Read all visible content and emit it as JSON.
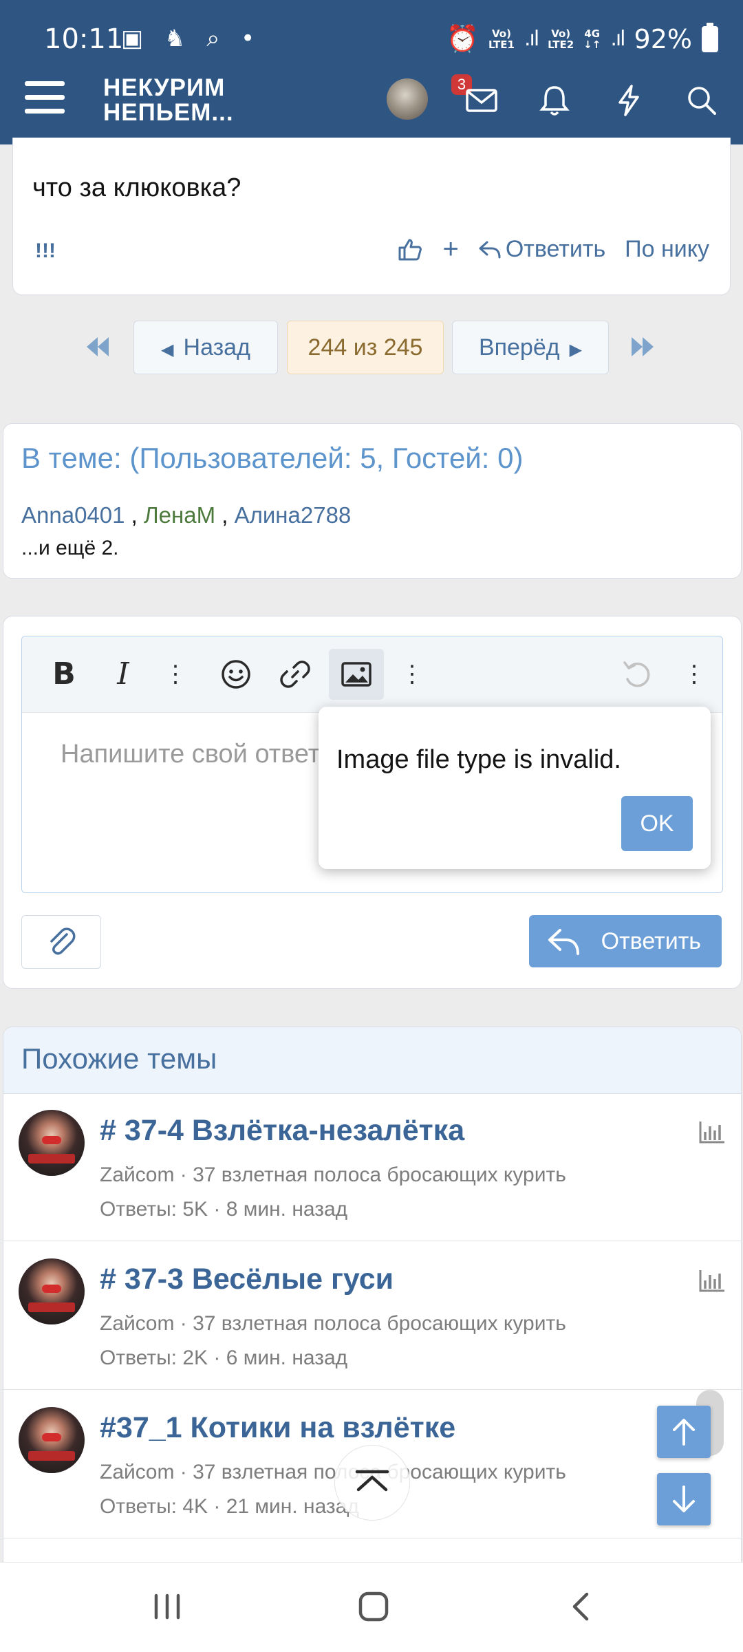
{
  "status_bar": {
    "time": "10:11",
    "battery": "92%",
    "sim1": "LTE1",
    "sim2": "LTE2",
    "network": "4G"
  },
  "header": {
    "logo_line1": "НЕКУРИМ",
    "logo_line2": "НЕПЬЕМ...",
    "inbox_badge": "3"
  },
  "post": {
    "text": "что за клюковка?",
    "marker": "!!!",
    "reply_label": "Ответить",
    "by_nick_label": "По нику",
    "plus_label": "+"
  },
  "pager": {
    "back_label": "Назад",
    "current": "244 из 245",
    "forward_label": "Вперёд"
  },
  "in_topic": {
    "title": "В теме: (Пользователей: 5, Гостей: 0)",
    "users": [
      "Anna0401",
      "ЛенаМ",
      "Алина2788"
    ],
    "sep": ",",
    "more": "...и ещё 2."
  },
  "reply_box": {
    "placeholder": "Напишите свой ответ",
    "submit_label": "Ответить"
  },
  "dialog": {
    "message": "Image file type is invalid.",
    "ok_label": "OK"
  },
  "similar": {
    "title": "Похожие темы",
    "items": [
      {
        "title": "# 37-4 Взлётка-незалётка",
        "meta": "Zaйcom · 37 взлетная полоса бросающих курить",
        "stats": "Ответы: 5K · 8 мин. назад"
      },
      {
        "title": "# 37-3 Весёлые гуси",
        "meta": "Zaйcom · 37 взлетная полоса бросающих курить",
        "stats": "Ответы: 2K · 6 мин. назад"
      },
      {
        "title": "#37_1 Котики на взлётке",
        "meta": "Zaйcom · 37 взлетная полоса бросающих курить",
        "stats": "Ответы: 4K · 21 мин. назад"
      }
    ]
  },
  "colors": {
    "header": "#2f5683",
    "accent": "#6c9fd7",
    "link": "#47709f"
  }
}
